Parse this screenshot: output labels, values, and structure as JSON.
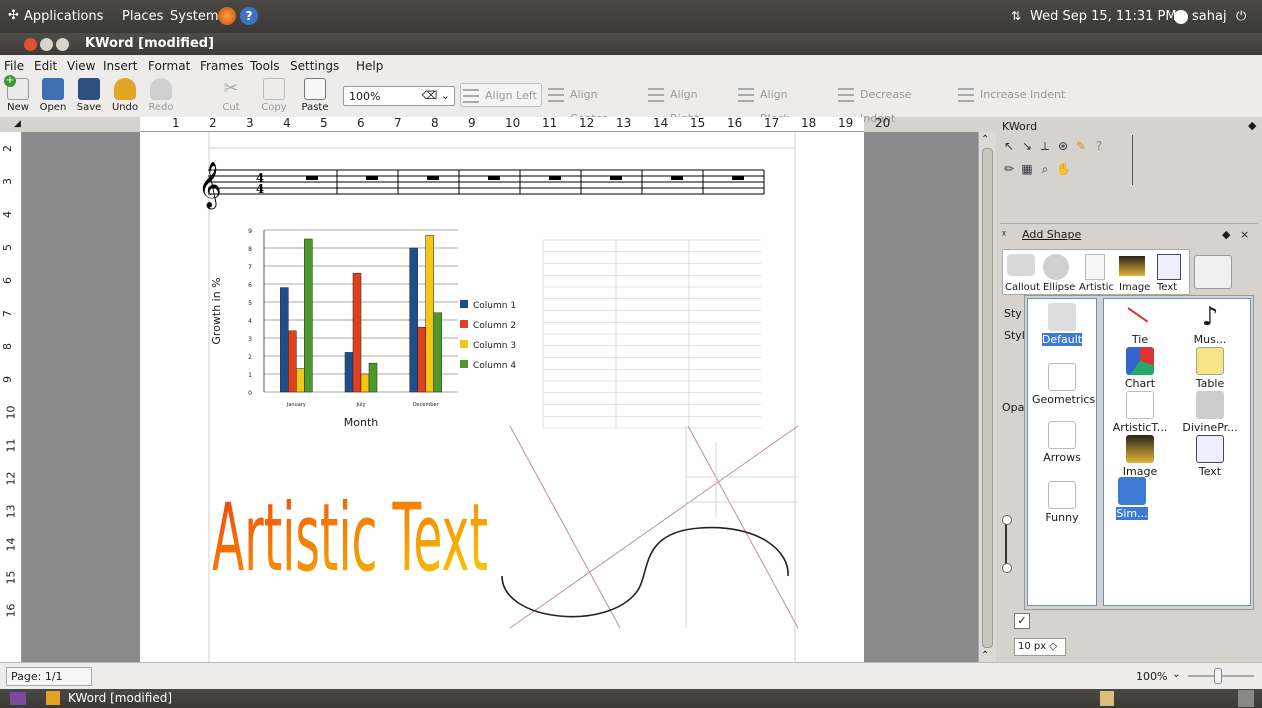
{
  "top_panel": {
    "menus": [
      "Applications",
      "Places",
      "System"
    ],
    "clock": "Wed Sep 15, 11:31 PM",
    "user": "sahaj"
  },
  "window": {
    "title": "KWord [modified]"
  },
  "menubar": [
    "File",
    "Edit",
    "View",
    "Insert",
    "Format",
    "Frames",
    "Tools",
    "Settings",
    "Help"
  ],
  "toolbar": {
    "new": "New",
    "open": "Open",
    "save": "Save",
    "undo": "Undo",
    "redo": "Redo",
    "cut": "Cut",
    "copy": "Copy",
    "paste": "Paste",
    "zoom": "100%",
    "align_left": "Align Left",
    "align_center": "Align Center",
    "align_right": "Align Right",
    "align_block": "Align Block",
    "decrease_indent": "Decrease Indent",
    "increase_indent": "Increase Indent"
  },
  "ruler": {
    "h_ticks": [
      "1",
      "2",
      "3",
      "4",
      "5",
      "6",
      "7",
      "8",
      "9",
      "10",
      "11",
      "12",
      "13",
      "14",
      "15",
      "16",
      "17",
      "18",
      "19",
      "20"
    ],
    "v_ticks": [
      "2",
      "3",
      "4",
      "5",
      "6",
      "7",
      "8",
      "9",
      "10",
      "11",
      "12",
      "13",
      "14",
      "15",
      "16"
    ]
  },
  "document": {
    "music_time_signature": "4/4",
    "artistic_text": "Artistic Text",
    "chart_data": {
      "type": "bar",
      "categories": [
        "January",
        "July",
        "December"
      ],
      "series": [
        {
          "name": "Column 1",
          "values": [
            5.8,
            2.2,
            8.0
          ],
          "color": "#1f4e8c"
        },
        {
          "name": "Column 2",
          "values": [
            3.4,
            6.6,
            3.6
          ],
          "color": "#e0401c"
        },
        {
          "name": "Column 3",
          "values": [
            1.3,
            1.0,
            8.7
          ],
          "color": "#f5c518"
        },
        {
          "name": "Column 4",
          "values": [
            8.5,
            1.6,
            4.4
          ],
          "color": "#4c9a2a"
        }
      ],
      "xlabel": "Month",
      "ylabel": "Growth in %",
      "ylim": [
        0,
        9
      ],
      "yticks": [
        "0",
        "1",
        "2",
        "3",
        "4",
        "5",
        "6",
        "7",
        "8",
        "9"
      ],
      "legend": "right",
      "grid": true
    }
  },
  "dock": {
    "kword_title": "KWord",
    "add_shape_title": "Add Shape",
    "shape_buttons": [
      "Callout",
      "Ellipse",
      "Artistic",
      "Image",
      "Text"
    ],
    "side_tabs": [
      "Sty",
      "Styl",
      "Opa"
    ],
    "px_value": "10 px"
  },
  "popup": {
    "categories": [
      "Default",
      "Geometrics",
      "Arrows",
      "Funny"
    ],
    "shapes": [
      "Tie",
      "Mus...",
      "Chart",
      "Table",
      "ArtisticT...",
      "DivinePr...",
      "Image",
      "Text",
      "Sim..."
    ]
  },
  "status": {
    "page": "Page: 1/1",
    "zoom": "100%"
  },
  "taskbar": {
    "item": "KWord [modified]"
  }
}
